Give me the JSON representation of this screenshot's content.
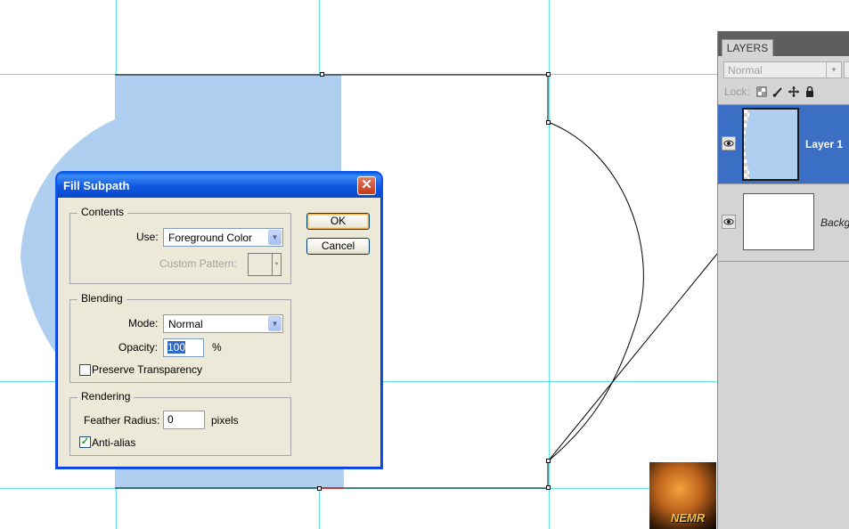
{
  "layers_panel": {
    "tab_label": "LAYERS",
    "blend_mode": "Normal",
    "lock_label": "Lock:",
    "lock_icons": [
      "lock-transparent-icon",
      "lock-image-icon",
      "lock-position-icon",
      "lock-all-icon"
    ],
    "layers": [
      {
        "name": "Layer 1",
        "selected": true,
        "visible": true
      },
      {
        "name": "Backgr",
        "selected": false,
        "visible": true
      }
    ]
  },
  "dialog": {
    "title": "Fill Subpath",
    "ok_label": "OK",
    "cancel_label": "Cancel",
    "contents": {
      "group_label": "Contents",
      "use_label": "Use:",
      "use_value": "Foreground Color",
      "custom_pattern_label": "Custom Pattern:"
    },
    "blending": {
      "group_label": "Blending",
      "mode_label": "Mode:",
      "mode_value": "Normal",
      "opacity_label": "Opacity:",
      "opacity_value": "100",
      "opacity_unit": "%",
      "preserve_transparency_label": "Preserve Transparency",
      "preserve_transparency_checked": false
    },
    "rendering": {
      "group_label": "Rendering",
      "feather_label": "Feather Radius:",
      "feather_value": "0",
      "feather_unit": "pixels",
      "antialias_label": "Anti-alias",
      "antialias_checked": true
    }
  },
  "watermark": {
    "text": "NEMR"
  },
  "colors": {
    "guide": "#66e0e8",
    "fill": "#aecff0",
    "selection": "#3a6fc4",
    "titlebar": "#0a55e8"
  }
}
